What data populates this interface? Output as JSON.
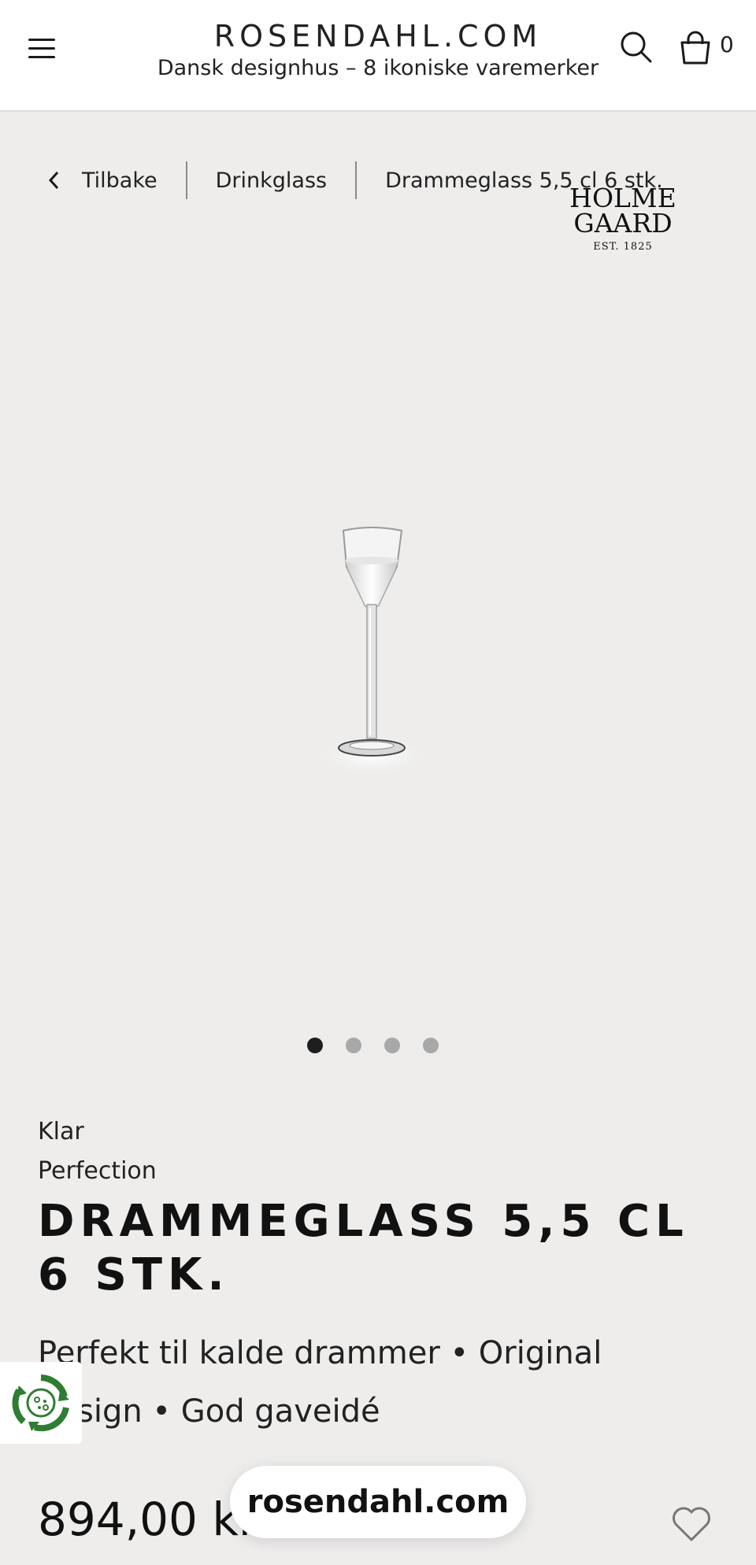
{
  "header": {
    "brand_name": "ROSENDAHL.COM",
    "tagline": "Dansk designhus – 8 ikoniske varemerker",
    "cart_count": "0",
    "icons": [
      "menu-icon",
      "search-icon",
      "shopping-bag-icon"
    ]
  },
  "breadcrumb": {
    "back": "Tilbake",
    "category": "Drinkglass",
    "current": "Drammeglass 5,5 cl 6 stk."
  },
  "brand_logo": {
    "line1": "HOLME",
    "line2": "GAARD",
    "est": "EST. 1825"
  },
  "gallery": {
    "slides": 4,
    "active_slide": 1
  },
  "product": {
    "color": "Klar",
    "series": "Perfection",
    "title": "DRAMMEGLASS 5,5 CL 6 STK.",
    "usps": "Perfekt til kalde drammer • Original design • God gaveidé",
    "price": "894,00 kr"
  },
  "url_pill": "rosendahl.com",
  "colors": {
    "page_bg": "#eeedec",
    "header_bg": "#ffffff",
    "text": "#1a1a1a",
    "eco_green": "#2e7d32"
  }
}
